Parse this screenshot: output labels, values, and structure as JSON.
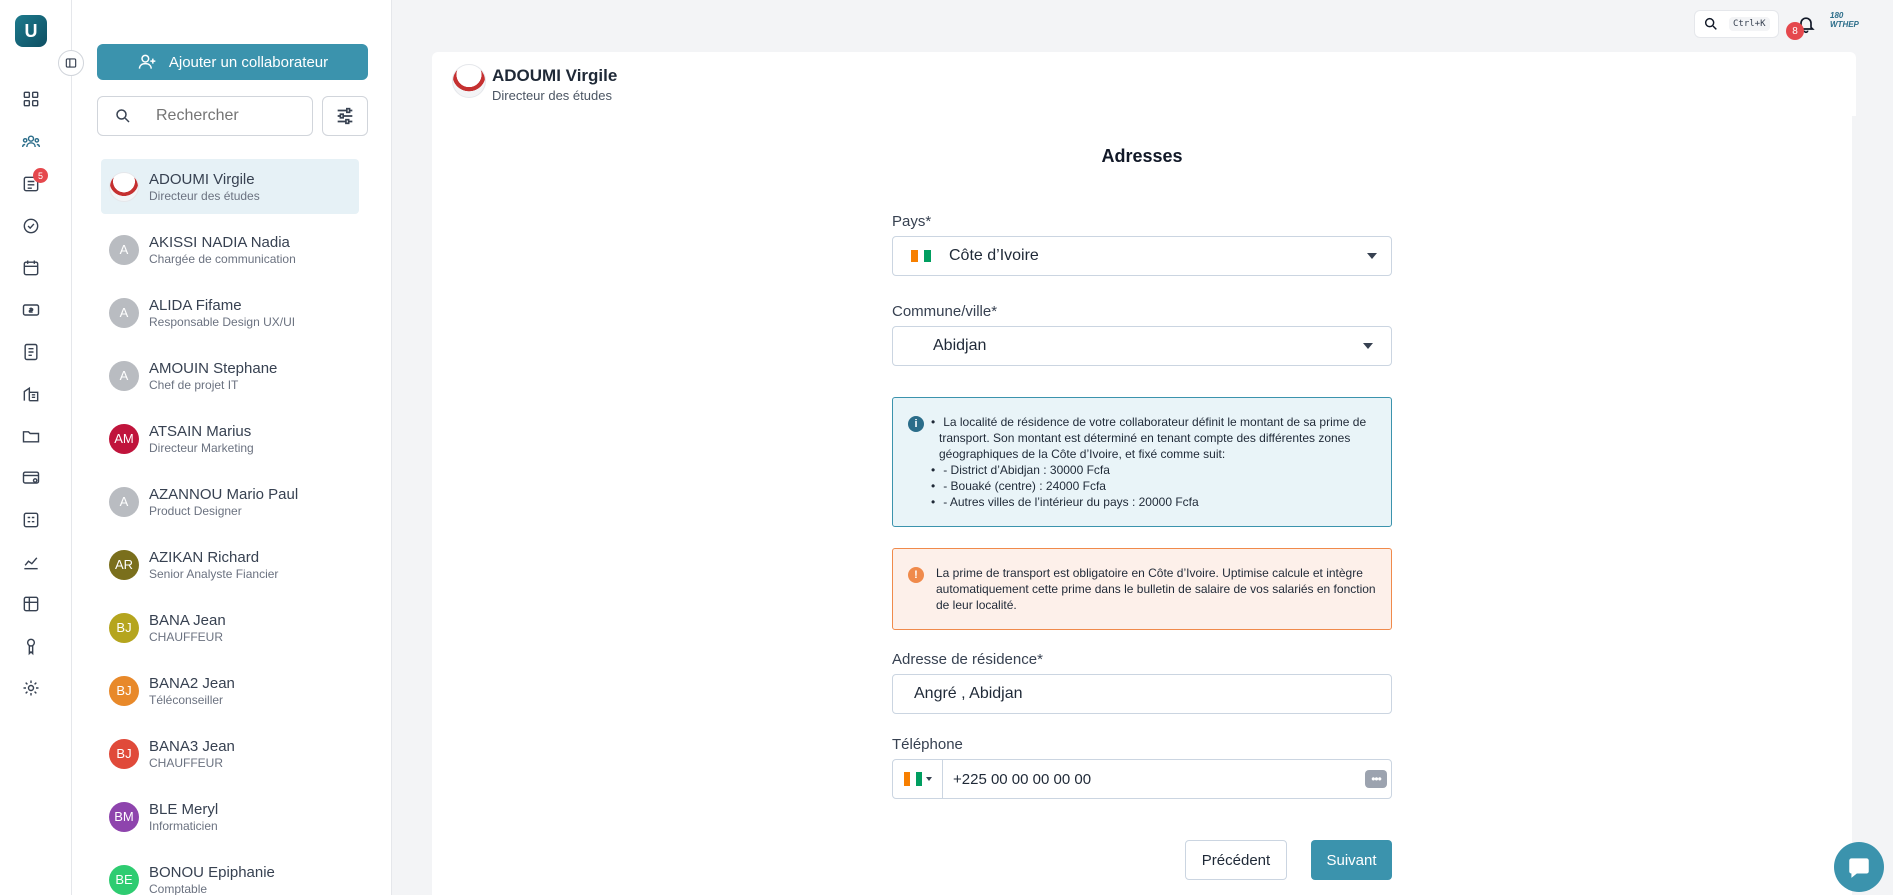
{
  "rail": {
    "logo": "U",
    "notif_badge": "5",
    "items": [
      "dashboard-icon",
      "team-icon",
      "requests-icon",
      "tasks-icon",
      "calendar-icon",
      "payroll-icon",
      "document-icon",
      "company-icon",
      "folder-icon",
      "cards-icon",
      "grid-icon",
      "stats-icon",
      "table-icon",
      "award-icon",
      "settings-icon"
    ]
  },
  "sidebar": {
    "add_button": "Ajouter un collaborateur",
    "search_placeholder": "Rechercher",
    "employees": [
      {
        "initials": "",
        "name": "ADOUMI Virgile",
        "role": "Directeur des études",
        "color": "",
        "photo": true,
        "selected": true
      },
      {
        "initials": "A",
        "name": "AKISSI NADIA Nadia",
        "role": "Chargée de communication",
        "color": "#b9bcc1"
      },
      {
        "initials": "A",
        "name": "ALIDA Fifame",
        "role": "Responsable Design UX/UI",
        "color": "#b9bcc1"
      },
      {
        "initials": "A",
        "name": "AMOUIN Stephane",
        "role": "Chef de projet IT",
        "color": "#b9bcc1"
      },
      {
        "initials": "AM",
        "name": "ATSAIN Marius",
        "role": "Directeur Marketing",
        "color": "#c0143c"
      },
      {
        "initials": "A",
        "name": "AZANNOU Mario Paul",
        "role": "Product Designer",
        "color": "#b9bcc1"
      },
      {
        "initials": "AR",
        "name": "AZIKAN Richard",
        "role": "Senior Analyste Fiancier",
        "color": "#7a6f1c"
      },
      {
        "initials": "BJ",
        "name": "BANA Jean",
        "role": "CHAUFFEUR",
        "color": "#b5a51e"
      },
      {
        "initials": "BJ",
        "name": "BANA2 Jean",
        "role": "Téléconseiller",
        "color": "#e8892a"
      },
      {
        "initials": "BJ",
        "name": "BANA3 Jean",
        "role": "CHAUFFEUR",
        "color": "#e04a3a"
      },
      {
        "initials": "BM",
        "name": "BLE Meryl",
        "role": "Informaticien",
        "color": "#8e44ad"
      },
      {
        "initials": "BE",
        "name": "BONOU Epiphanie",
        "role": "Comptable",
        "color": "#2ecc71"
      }
    ]
  },
  "topbar": {
    "shortcut": "Ctrl+K",
    "bell_badge": "8",
    "brand": "180 WTHEP"
  },
  "header": {
    "name": "ADOUMI Virgile",
    "role": "Directeur des études"
  },
  "form": {
    "title": "Adresses",
    "country_label": "Pays*",
    "country_value": "Côte d’Ivoire",
    "city_label": "Commune/ville*",
    "city_value": "Abidjan",
    "info_lines": [
      "La localité de résidence de votre collaborateur définit le montant de sa prime de transport. Son montant est déterminé en tenant compte des différentes zones géographiques de la Côte d’Ivoire, et fixé comme suit:",
      "- District d’Abidjan : 30000 Fcfa",
      "- Bouaké (centre) : 24000 Fcfa",
      "- Autres villes de l’intérieur du pays : 20000 Fcfa"
    ],
    "warning": "La prime de transport est obligatoire en Côte d’Ivoire. Uptimise calcule et intègre automatiquement cette prime dans le bulletin de salaire de vos salariés en fonction de leur localité.",
    "address_label": "Adresse de résidence*",
    "address_value": "Angré , Abidjan",
    "phone_label": "Téléphone",
    "phone_value": "+225 00 00 00 00 00",
    "prev_button": "Précédent",
    "next_button": "Suivant"
  },
  "colors": {
    "accent": "#3b93ad",
    "info_bg": "#e9f4f8",
    "warning_border": "#f08a4b",
    "badge": "#e5484d"
  }
}
